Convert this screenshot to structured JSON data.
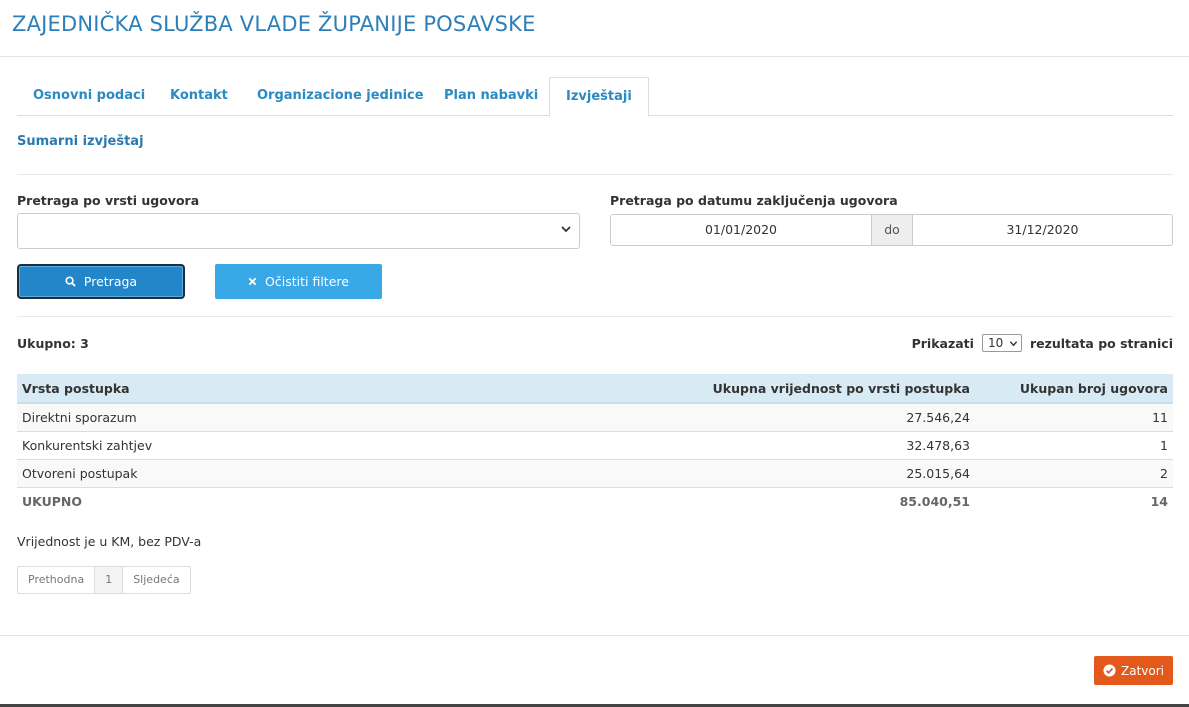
{
  "header": {
    "title": "ZAJEDNIČKA SLUŽBA VLADE ŽUPANIJE POSAVSKE"
  },
  "tabs": [
    {
      "label": "Osnovni podaci",
      "active": false
    },
    {
      "label": "Kontakt",
      "active": false
    },
    {
      "label": "Organizacione jedinice",
      "active": false
    },
    {
      "label": "Plan nabavki",
      "active": false
    },
    {
      "label": "Izvještaji",
      "active": true
    }
  ],
  "section": {
    "title": "Sumarni izvještaj"
  },
  "filters": {
    "contract_type_label": "Pretraga po vrsti ugovora",
    "contract_type_value": "",
    "date_label": "Pretraga po datumu zaključenja ugovora",
    "date_from": "01/01/2020",
    "date_separator": "do",
    "date_to": "31/12/2020",
    "search_button": "Pretraga",
    "clear_button": "Očistiti filtere"
  },
  "results": {
    "total_label": "Ukupno: 3",
    "show_label": "Prikazati",
    "per_page": "10",
    "per_page_suffix": "rezultata po stranici"
  },
  "table": {
    "headers": [
      "Vrsta postupka",
      "Ukupna vrijednost po vrsti postupka",
      "Ukupan broj ugovora"
    ],
    "rows": [
      [
        "Direktni sporazum",
        "27.546,24",
        "11"
      ],
      [
        "Konkurentski zahtjev",
        "32.478,63",
        "1"
      ],
      [
        "Otvoreni postupak",
        "25.015,64",
        "2"
      ]
    ],
    "total_row": [
      "UKUPNO",
      "85.040,51",
      "14"
    ]
  },
  "note": "Vrijednost je u KM, bez PDV-a",
  "pagination": {
    "prev": "Prethodna",
    "page": "1",
    "next": "Sljedeća"
  },
  "footer": {
    "close_button": "Zatvori"
  },
  "colors": {
    "accent": "#2a8ac4",
    "close": "#e2591b",
    "table_header": "#d8ebf5"
  }
}
